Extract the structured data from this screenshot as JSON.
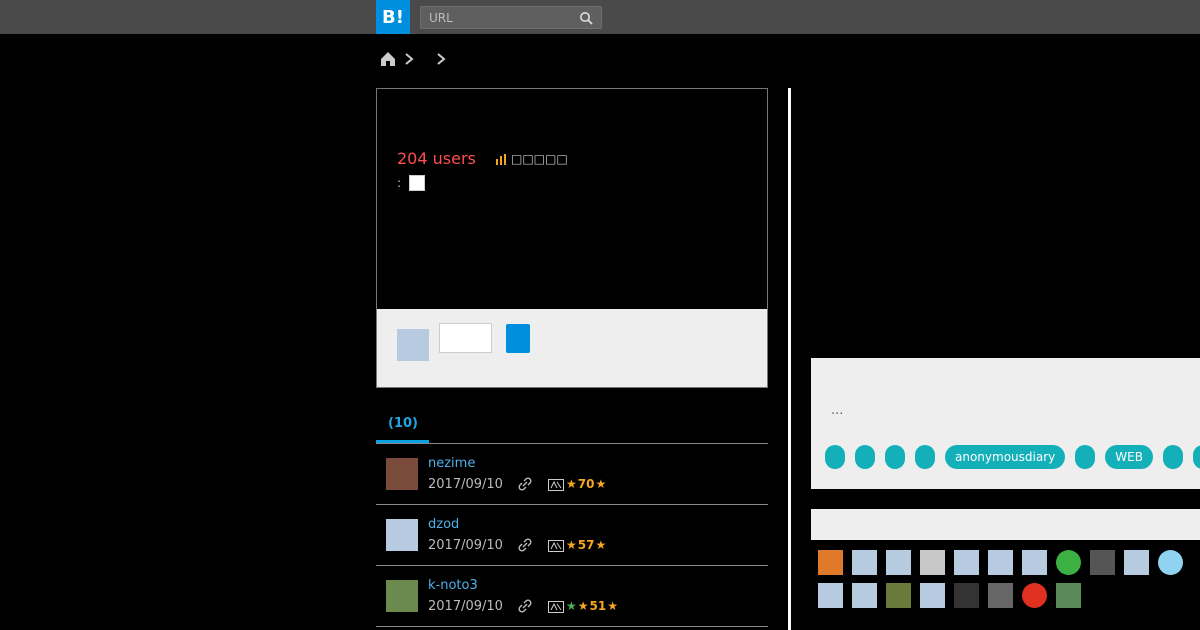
{
  "header": {
    "logo": "B!",
    "search_placeholder": "URL"
  },
  "entry": {
    "users": "204 users",
    "stat": "□□□□□",
    "via_label": ":"
  },
  "tabs": {
    "active_label": "(10)"
  },
  "bookmarks": [
    {
      "user": "nezime",
      "date": "2017/09/10",
      "stars": "70"
    },
    {
      "user": "dzod",
      "date": "2017/09/10",
      "stars": "57"
    },
    {
      "user": "k-noto3",
      "date": "2017/09/10",
      "stars": "51"
    }
  ],
  "tagpanel": {
    "ellipsis": "...",
    "tags": [
      "",
      "",
      "",
      "",
      "anonymousdiary",
      "",
      "WEB",
      "",
      ""
    ]
  },
  "colors": {
    "brand": "#008fde",
    "tag": "#13b0ba",
    "users": "#ff4e4e",
    "star": "#f6a623",
    "link": "#4fb0e8"
  }
}
